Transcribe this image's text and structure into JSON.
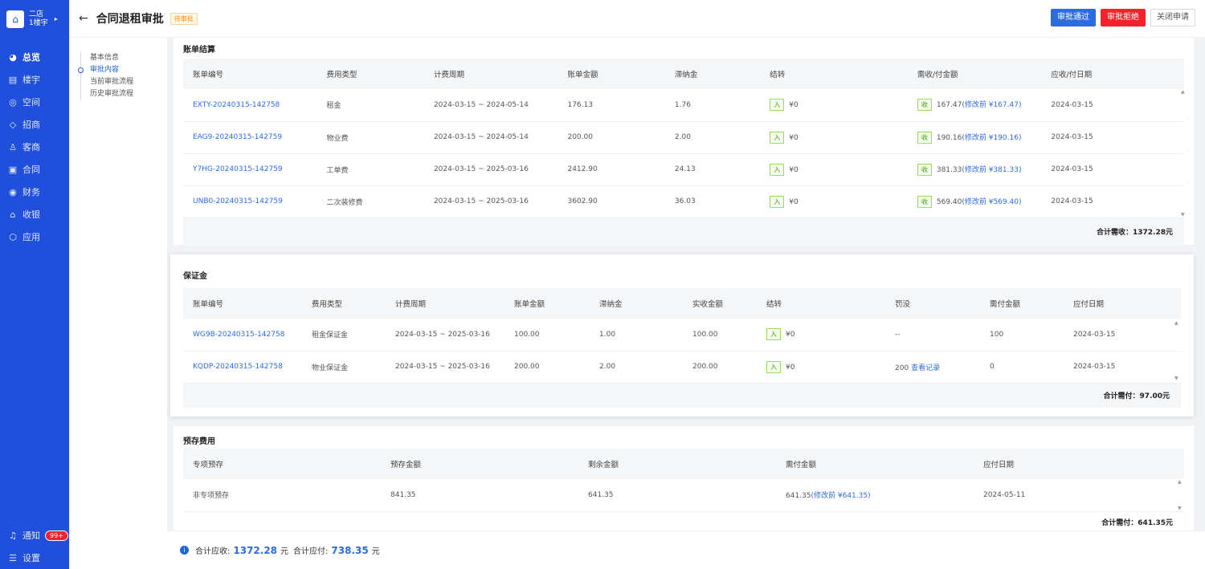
{
  "brand": {
    "line1": "二店",
    "line2": "1楼宇",
    "logo": "building-icon"
  },
  "nav": [
    {
      "icon": "◕",
      "label": "总览"
    },
    {
      "icon": "▤",
      "label": "楼宇"
    },
    {
      "icon": "◎",
      "label": "空间"
    },
    {
      "icon": "◇",
      "label": "招商"
    },
    {
      "icon": "♙",
      "label": "客商"
    },
    {
      "icon": "▣",
      "label": "合同"
    },
    {
      "icon": "◉",
      "label": "财务"
    },
    {
      "icon": "⌂",
      "label": "收银"
    },
    {
      "icon": "⬡",
      "label": "应用"
    }
  ],
  "sidebar_bottom": {
    "notify_label": "通知",
    "notify_badge": "99+",
    "settings_label": "设置"
  },
  "header": {
    "title": "合同退租审批",
    "status": "待审批",
    "approve": "审批通过",
    "reject": "审批拒绝",
    "close": "关闭申请"
  },
  "anchors": [
    "基本信息",
    "审批内容",
    "当前审批流程",
    "历史审批流程"
  ],
  "bill": {
    "title": "账单结算",
    "columns": [
      "账单编号",
      "费用类型",
      "计费周期",
      "账单金额",
      "滞纳金",
      "结转",
      "需收/付金额",
      "应收/付日期"
    ],
    "rows": [
      {
        "id": "EXTY-20240315-142758",
        "type": "租金",
        "period": "2024-03-15 ~ 2024-05-14",
        "amount": "176.13",
        "late": "1.76",
        "carry_tag": "入",
        "carry": "¥0",
        "need_tag": "收",
        "need": "167.47",
        "before": "(修改前 ¥167.47)",
        "date": "2024-03-15"
      },
      {
        "id": "EAG9-20240315-142759",
        "type": "物业费",
        "period": "2024-03-15 ~ 2024-05-14",
        "amount": "200.00",
        "late": "2.00",
        "carry_tag": "入",
        "carry": "¥0",
        "need_tag": "收",
        "need": "190.16",
        "before": "(修改前 ¥190.16)",
        "date": "2024-03-15"
      },
      {
        "id": "Y7HG-20240315-142759",
        "type": "工单费",
        "period": "2024-03-15 ~ 2025-03-16",
        "amount": "2412.90",
        "late": "24.13",
        "carry_tag": "入",
        "carry": "¥0",
        "need_tag": "收",
        "need": "381.33",
        "before": "(修改前 ¥381.33)",
        "date": "2024-03-15"
      },
      {
        "id": "UNB0-20240315-142759",
        "type": "二次装修费",
        "period": "2024-03-15 ~ 2025-03-16",
        "amount": "3602.90",
        "late": "36.03",
        "carry_tag": "入",
        "carry": "¥0",
        "need_tag": "收",
        "need": "569.40",
        "before": "(修改前 ¥569.40)",
        "date": "2024-03-15"
      }
    ],
    "total": "合计需收：1372.28元"
  },
  "deposit": {
    "title": "保证金",
    "columns": [
      "账单编号",
      "费用类型",
      "计费周期",
      "账单金额",
      "滞纳金",
      "实收金额",
      "结转",
      "罚没",
      "需付金额",
      "应付日期"
    ],
    "rows": [
      {
        "id": "WG9B-20240315-142758",
        "type": "租金保证金",
        "period": "2024-03-15 ~ 2025-03-16",
        "amount": "100.00",
        "late": "1.00",
        "received": "100.00",
        "carry_tag": "入",
        "carry": "¥0",
        "forfeit": "--",
        "forfeit_link": "",
        "need": "100",
        "date": "2024-03-15"
      },
      {
        "id": "KQDP-20240315-142758",
        "type": "物业保证金",
        "period": "2024-03-15 ~ 2025-03-16",
        "amount": "200.00",
        "late": "2.00",
        "received": "200.00",
        "carry_tag": "入",
        "carry": "¥0",
        "forfeit": "200",
        "forfeit_link": "查看记录",
        "need": "0",
        "date": "2024-03-15"
      }
    ],
    "total": "合计需付：97.00元"
  },
  "prestore": {
    "title": "预存费用",
    "columns": [
      "专项预存",
      "预存金额",
      "剩余金额",
      "需付金额",
      "应付日期"
    ],
    "rows": [
      {
        "name": "非专项预存",
        "amount": "841.35",
        "remain": "641.35",
        "need": "641.35",
        "before": "(修改前 ¥641.35)",
        "date": "2024-05-11"
      }
    ],
    "total": "合计需付：641.35元"
  },
  "footer": {
    "recv_label": "合计应收:",
    "recv": "1372.28",
    "unit1": "元",
    "pay_label": "合计应付:",
    "pay": "738.35",
    "unit2": "元"
  }
}
